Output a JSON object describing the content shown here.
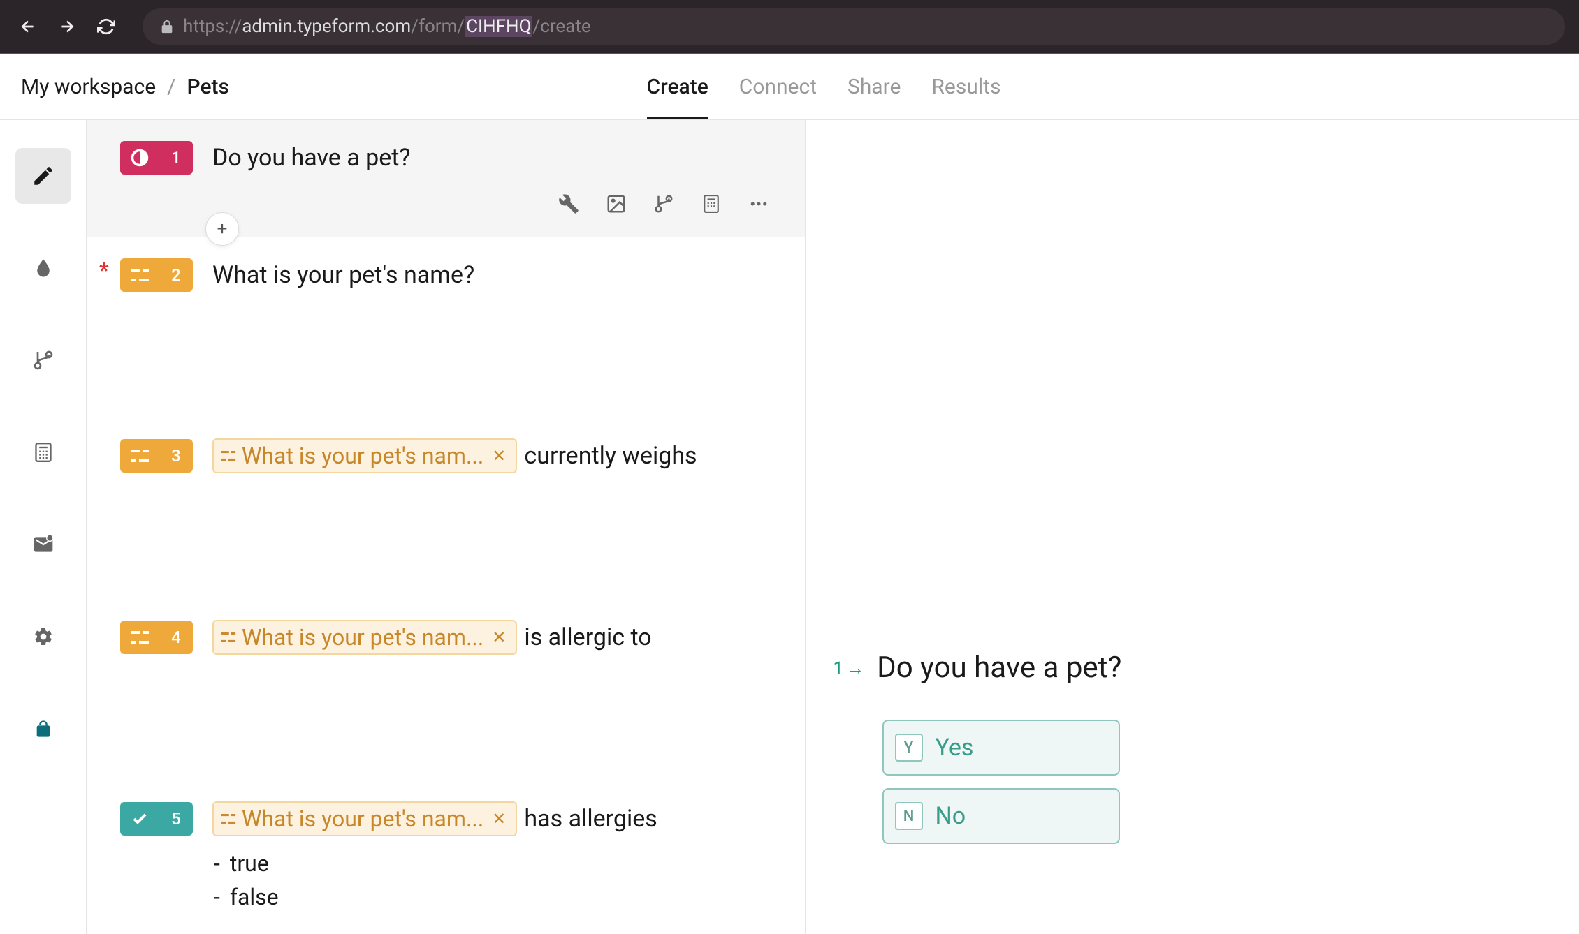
{
  "browser": {
    "url_prefix": "https://",
    "url_host": "admin.typeform.com",
    "url_path1": "/form/",
    "url_highlight": "CIHFHQ",
    "url_path2": "/create"
  },
  "breadcrumb": {
    "workspace": "My workspace",
    "separator": "/",
    "form": "Pets"
  },
  "tabs": {
    "create": "Create",
    "connect": "Connect",
    "share": "Share",
    "results": "Results"
  },
  "questions": [
    {
      "number": "1",
      "type": "yesno",
      "title": "Do you have a pet?",
      "selected": true,
      "required": false
    },
    {
      "number": "2",
      "type": "text",
      "title": "What is your pet's name?",
      "required": true
    },
    {
      "number": "3",
      "type": "text",
      "recall": "What is your pet's nam...",
      "suffix": "currently weighs"
    },
    {
      "number": "4",
      "type": "text",
      "recall": "What is your pet's nam...",
      "suffix": "is allergic to"
    },
    {
      "number": "5",
      "type": "bool",
      "recall": "What is your pet's nam...",
      "suffix": "has allergies",
      "options": [
        "true",
        "false"
      ]
    }
  ],
  "preview": {
    "number": "1",
    "title": "Do you have a pet?",
    "options": [
      {
        "key": "Y",
        "label": "Yes"
      },
      {
        "key": "N",
        "label": "No"
      }
    ]
  },
  "icons": {
    "add": "+"
  }
}
